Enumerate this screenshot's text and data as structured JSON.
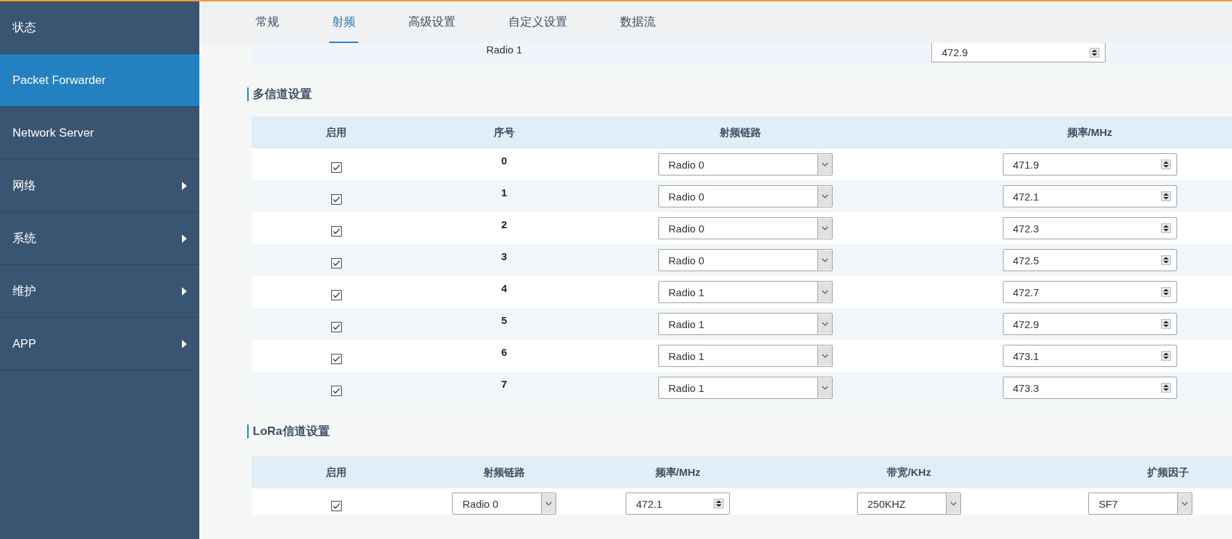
{
  "sidebar": {
    "items": [
      {
        "label": "状态",
        "selected": false,
        "has_submenu": false
      },
      {
        "label": "Packet Forwarder",
        "selected": true,
        "has_submenu": false
      },
      {
        "label": "Network Server",
        "selected": false,
        "has_submenu": false
      },
      {
        "label": "网络",
        "selected": false,
        "has_submenu": true
      },
      {
        "label": "系统",
        "selected": false,
        "has_submenu": true
      },
      {
        "label": "维护",
        "selected": false,
        "has_submenu": true
      },
      {
        "label": "APP",
        "selected": false,
        "has_submenu": true
      }
    ]
  },
  "tabs": [
    {
      "label": "常规",
      "selected": false
    },
    {
      "label": "射频",
      "selected": true
    },
    {
      "label": "高级设置",
      "selected": false
    },
    {
      "label": "自定义设置",
      "selected": false
    },
    {
      "label": "数据流",
      "selected": false
    }
  ],
  "radio_row": {
    "label": "Radio 1",
    "value": "472.9"
  },
  "multi_channel": {
    "title": "多信道设置",
    "columns": [
      "启用",
      "序号",
      "射频链路",
      "频率/MHz"
    ],
    "rows": [
      {
        "enabled": true,
        "index": "0",
        "radio": "Radio 0",
        "frequency": "471.9"
      },
      {
        "enabled": true,
        "index": "1",
        "radio": "Radio 0",
        "frequency": "472.1"
      },
      {
        "enabled": true,
        "index": "2",
        "radio": "Radio 0",
        "frequency": "472.3"
      },
      {
        "enabled": true,
        "index": "3",
        "radio": "Radio 0",
        "frequency": "472.5"
      },
      {
        "enabled": true,
        "index": "4",
        "radio": "Radio 1",
        "frequency": "472.7"
      },
      {
        "enabled": true,
        "index": "5",
        "radio": "Radio 1",
        "frequency": "472.9"
      },
      {
        "enabled": true,
        "index": "6",
        "radio": "Radio 1",
        "frequency": "473.1"
      },
      {
        "enabled": true,
        "index": "7",
        "radio": "Radio 1",
        "frequency": "473.3"
      }
    ]
  },
  "lora_channel": {
    "title": "LoRa信道设置",
    "columns": [
      "启用",
      "射频链路",
      "频率/MHz",
      "带宽/KHz",
      "扩频因子"
    ],
    "rows": [
      {
        "enabled": true,
        "radio": "Radio 0",
        "frequency": "472.1",
        "bandwidth": "250KHZ",
        "spreading_factor": "SF7"
      }
    ]
  }
}
